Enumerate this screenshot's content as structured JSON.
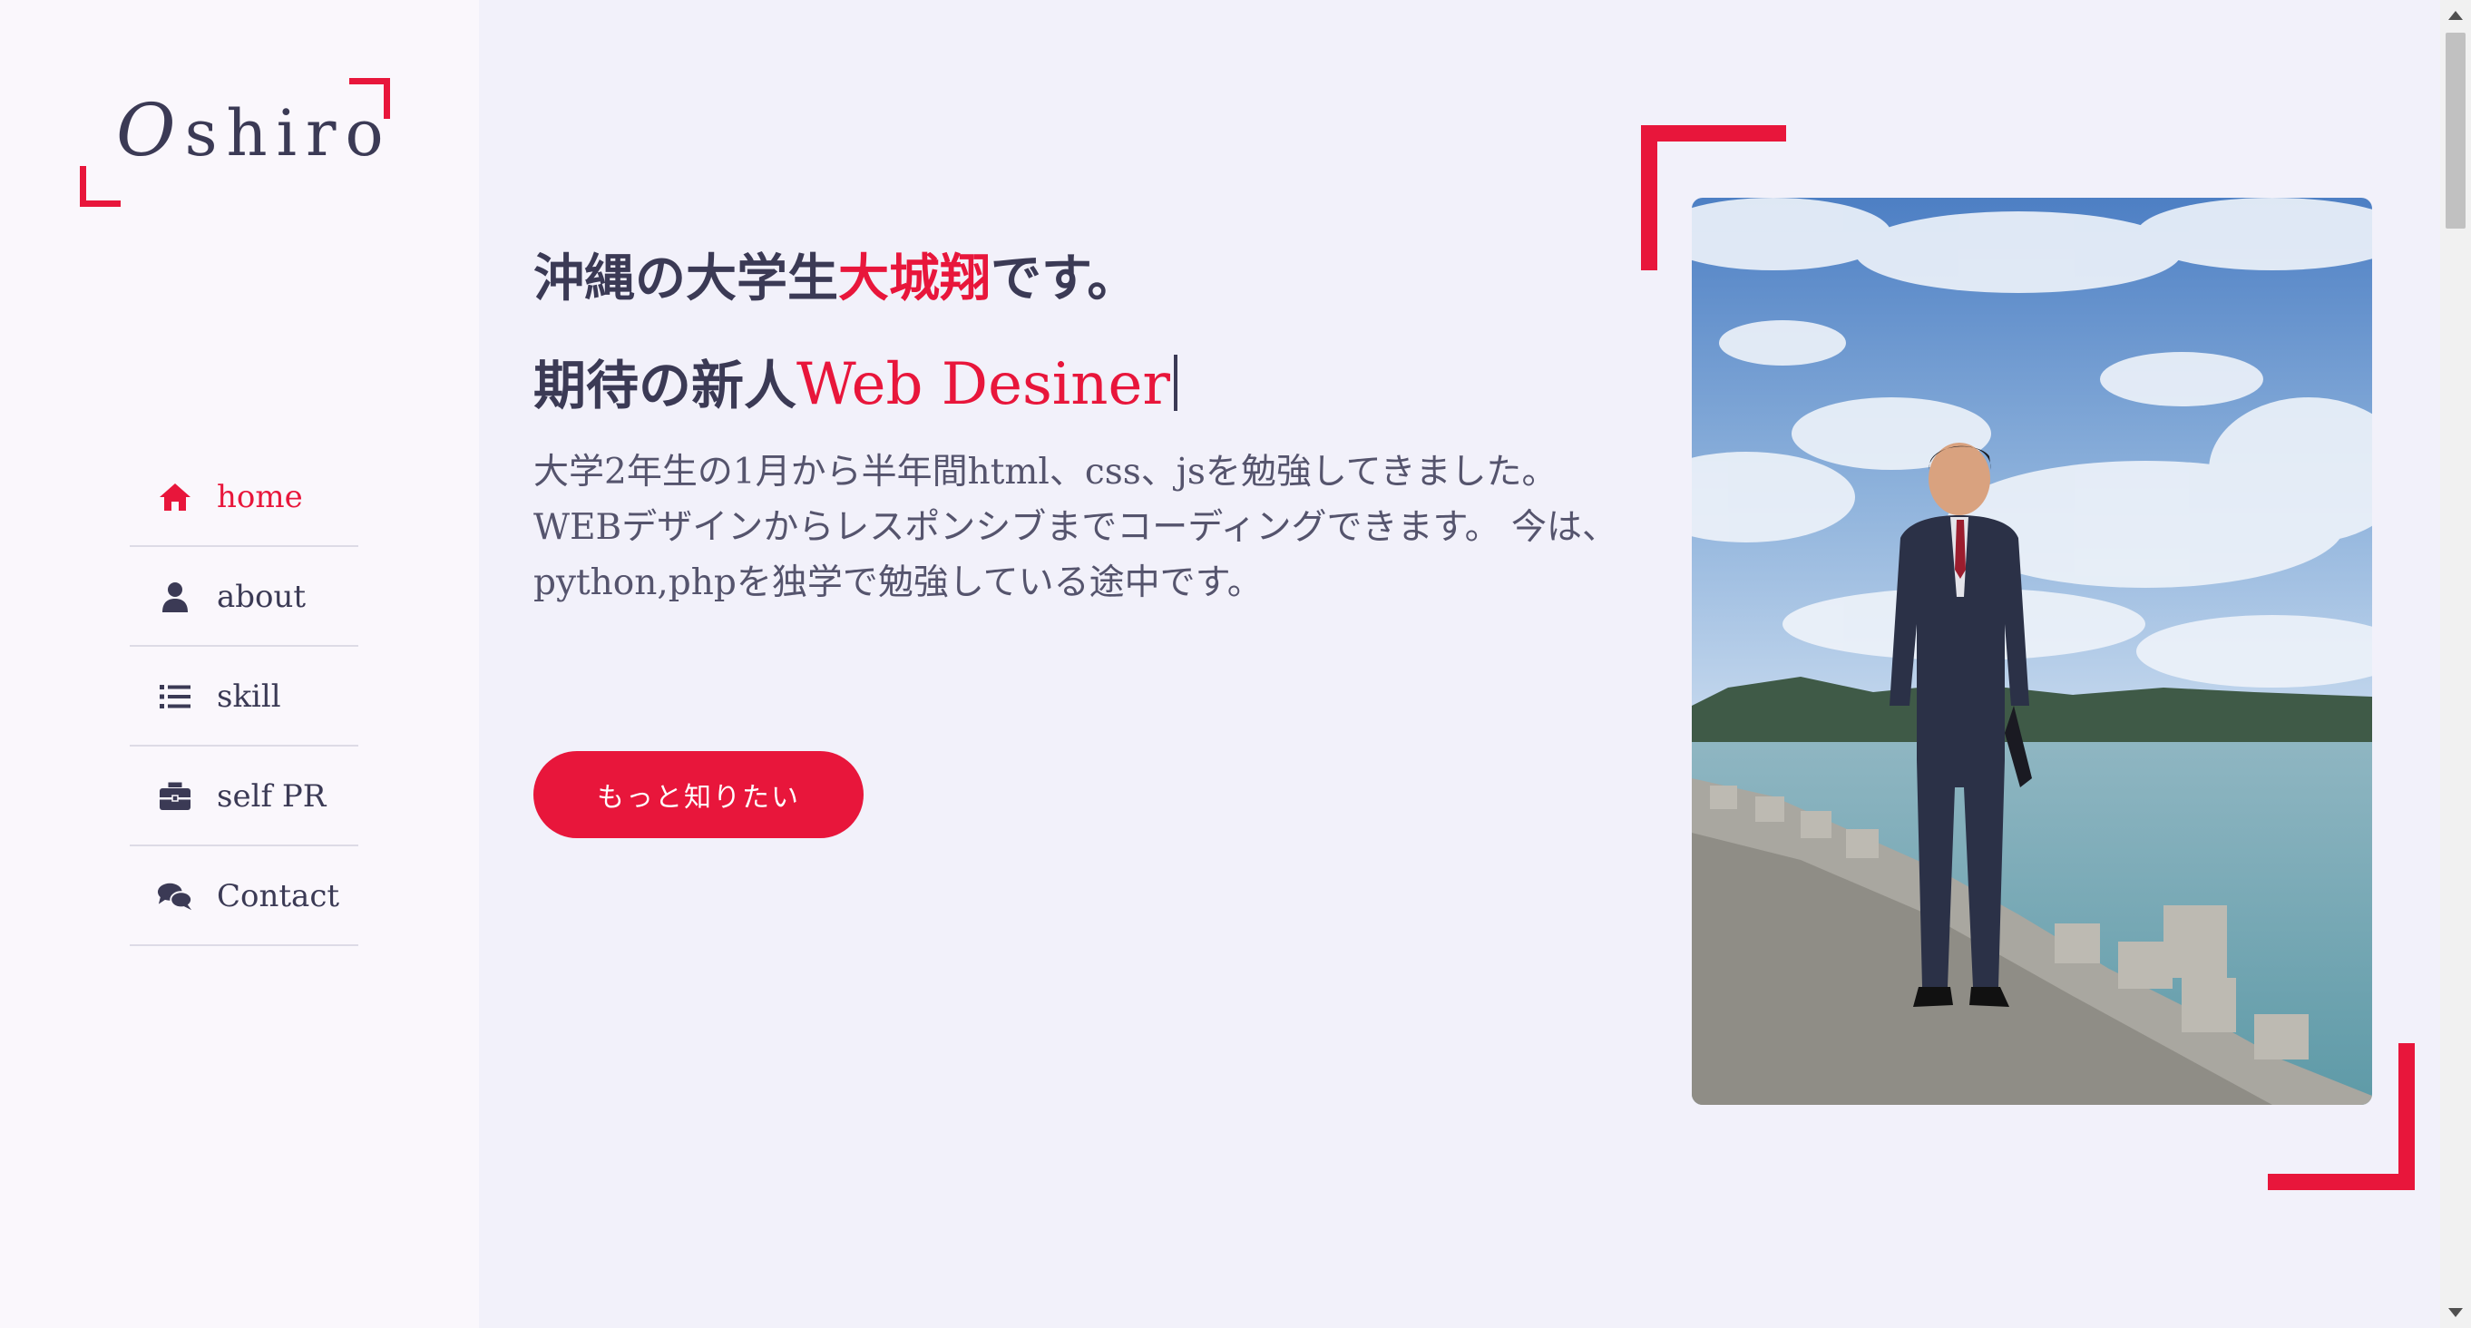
{
  "logo": {
    "first_letter": "O",
    "rest": "shiro"
  },
  "nav": {
    "items": [
      {
        "label": "home",
        "icon": "home-icon",
        "active": true
      },
      {
        "label": "about",
        "icon": "user-icon",
        "active": false
      },
      {
        "label": "skill",
        "icon": "list-icon",
        "active": false
      },
      {
        "label": "self PR",
        "icon": "briefcase-icon",
        "active": false
      },
      {
        "label": "Contact",
        "icon": "comments-icon",
        "active": false
      }
    ]
  },
  "hero": {
    "line1_prefix": "沖縄の大学生",
    "line1_name": "大城翔",
    "line1_suffix": "です。",
    "line2_prefix": "期待の新人",
    "line2_typed": "Web Desiner",
    "description": "大学2年生の1月から半年間html、css、jsを勉強してきました。WEBデザインからレスポンシブまでコーディングできます。 今は、python,phpを独学で勉強している途中です。",
    "cta_label": "もっと知りたい"
  },
  "colors": {
    "accent": "#e8163b",
    "text": "#3b3a55",
    "sidebar_bg": "#faf7fc",
    "main_bg": "#f2f1fa"
  }
}
